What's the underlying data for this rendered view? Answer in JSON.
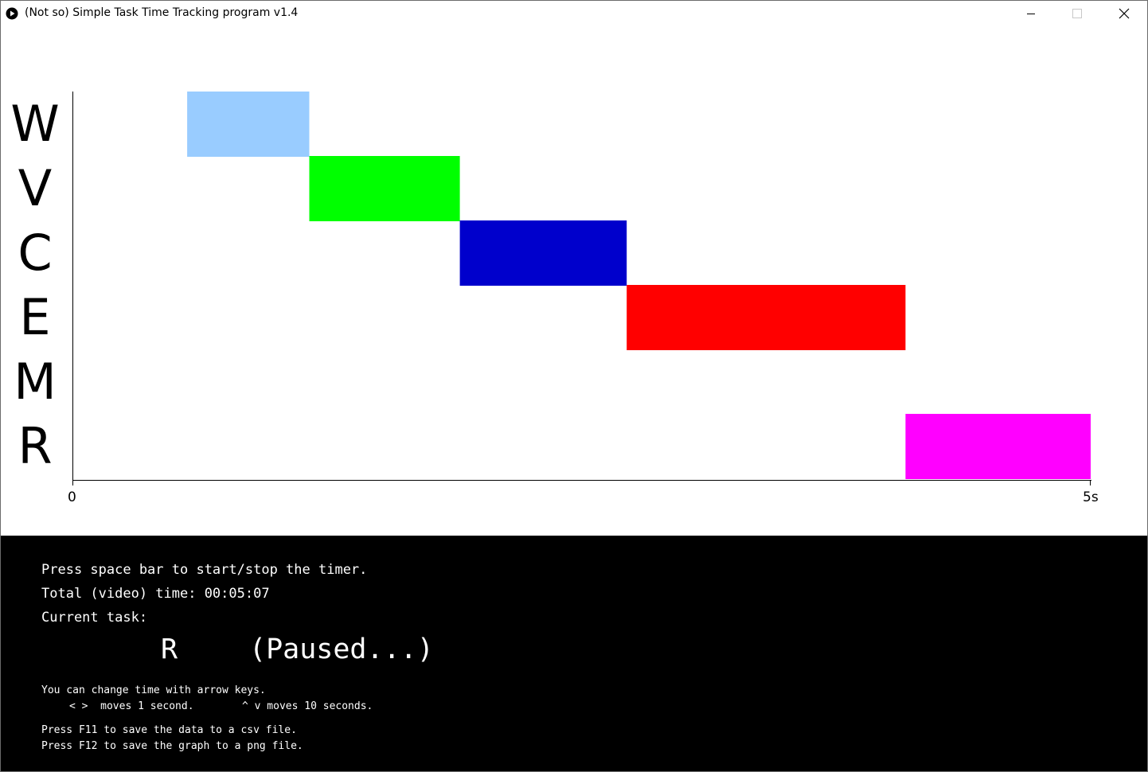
{
  "window": {
    "title": "(Not so) Simple Task Time Tracking program v1.4",
    "icon": "play-circle-icon",
    "controls": [
      "minimize-icon",
      "maximize-icon",
      "close-icon"
    ]
  },
  "chart_data": {
    "type": "bar",
    "orientation": "horizontal-timeline",
    "tasks": [
      "W",
      "V",
      "C",
      "E",
      "M",
      "R"
    ],
    "x_min_label": "0",
    "x_max_label": "5s",
    "xlim": [
      0,
      5
    ],
    "unit": "s",
    "segments": [
      {
        "task": "W",
        "start": 0.56,
        "end": 1.16,
        "color": "#99ccff"
      },
      {
        "task": "V",
        "start": 1.16,
        "end": 1.9,
        "color": "#00ff00"
      },
      {
        "task": "C",
        "start": 1.9,
        "end": 2.72,
        "color": "#0000cc"
      },
      {
        "task": "E",
        "start": 2.72,
        "end": 4.09,
        "color": "#ff0000"
      },
      {
        "task": "R",
        "start": 4.09,
        "end": 5.0,
        "color": "#ff00ff"
      }
    ],
    "grid": false
  },
  "panel": {
    "instruction": "Press space bar to start/stop the timer.",
    "total_time": "Total (video) time: 00:05:07",
    "current_task_label": "Current task:",
    "current_task": "R",
    "status": "(Paused...)",
    "hint_arrows": "You can change time with arrow keys.",
    "hint_left_right": "< >  moves 1 second.",
    "hint_up_down": "^ v moves 10 seconds.",
    "hint_f11": "Press F11 to save the data to a csv file.",
    "hint_f12": "Press F12 to save the graph to a png file."
  }
}
